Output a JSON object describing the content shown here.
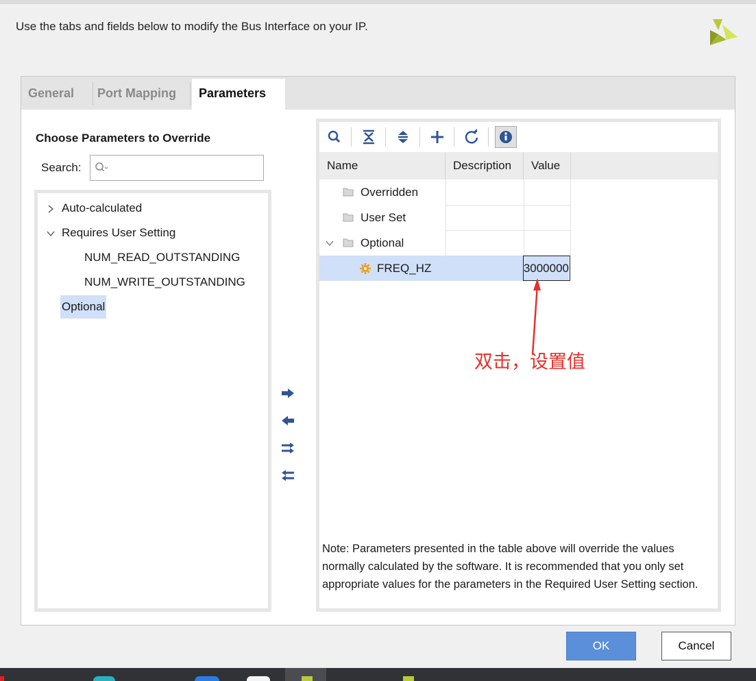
{
  "header": {
    "text": "Use the tabs and fields below to modify the Bus Interface on your IP."
  },
  "tabs": [
    {
      "label": "General",
      "active": false
    },
    {
      "label": "Port Mapping",
      "active": false
    },
    {
      "label": "Parameters",
      "active": true
    }
  ],
  "left_panel": {
    "title": "Choose Parameters to Override",
    "search_label": "Search:",
    "search_value": "",
    "tree": [
      {
        "label": "Auto-calculated",
        "expanded": false
      },
      {
        "label": "Requires User Setting",
        "expanded": true
      },
      {
        "label": "NUM_READ_OUTSTANDING"
      },
      {
        "label": "NUM_WRITE_OUTSTANDING"
      },
      {
        "label": "Optional",
        "selected": true
      }
    ]
  },
  "move_buttons": [
    "move-right",
    "move-left",
    "move-all-right",
    "move-all-left"
  ],
  "toolbar": [
    "search-icon",
    "collapse-all-icon",
    "expand-all-icon",
    "add-icon",
    "refresh-icon",
    "info-icon"
  ],
  "table": {
    "columns": [
      "Name",
      "Description",
      "Value"
    ],
    "rows": [
      {
        "name": "Overridden",
        "description": "",
        "value": ""
      },
      {
        "name": "User Set",
        "description": "",
        "value": ""
      },
      {
        "name": "Optional",
        "description": "",
        "value": "",
        "expanded": true
      },
      {
        "name": "FREQ_HZ",
        "description": "",
        "value": "3000000",
        "selected": true,
        "editing": true
      }
    ]
  },
  "note": "Note: Parameters presented in the table above will override the values normally calculated by the software. It is recommended that you only set appropriate values for the parameters in the Required User Setting section.",
  "annotation": "双击，设置值",
  "buttons": {
    "ok": "OK",
    "cancel": "Cancel"
  },
  "colors": {
    "accent": "#5b8fd9",
    "selection": "#cfe0f8",
    "annotation": "#e8302a"
  }
}
